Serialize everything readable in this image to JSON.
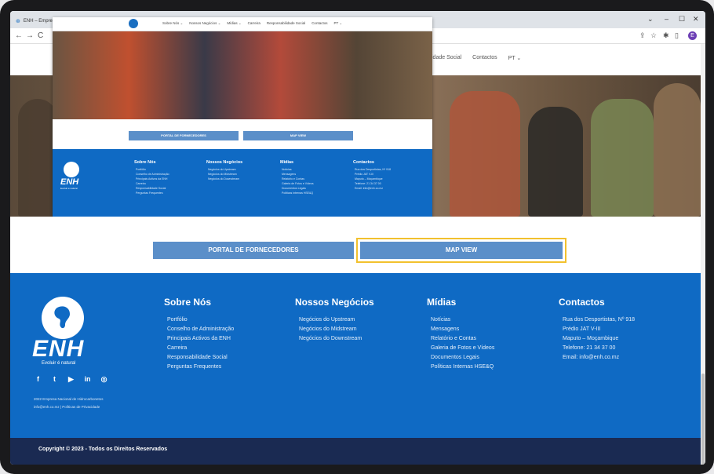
{
  "browser": {
    "tab_title": "ENH – Empre",
    "nav_back": "←",
    "nav_forward": "→",
    "nav_reload": "C",
    "profile_initial": "E",
    "win_min": "–",
    "win_max": "☐",
    "win_close": "✕",
    "tab_chevron": "⌄"
  },
  "bg_nav": [
    "idade Social",
    "Contactos",
    "PT ⌄"
  ],
  "overlay": {
    "nav": [
      "Sobre Nós ⌄",
      "Nossos Negócios ⌄",
      "Mídias ⌄",
      "Carreira",
      "Responsabilidade Social",
      "Contactos",
      "PT ⌄"
    ],
    "btn_fornecedores": "PORTAL DE FORNECEDORES",
    "btn_map": "MAP VIEW",
    "cols": [
      {
        "title": "Sobre Nós",
        "items": [
          "Portfólio",
          "Conselho de Administração",
          "Principais Activos da ENH",
          "Carreira",
          "Responsabilidade Social",
          "Perguntas Frequentes"
        ]
      },
      {
        "title": "Nossos Negócios",
        "items": [
          "Negócios do Upstream",
          "Negócios do Midstream",
          "Negócios do Downstream"
        ]
      },
      {
        "title": "Mídias",
        "items": [
          "Notícias",
          "Mensagens",
          "Relatório e Contas",
          "Galeria de Fotos e Vídeos",
          "Documentos Legais",
          "Políticas Internas HSE&Q"
        ]
      },
      {
        "title": "Contactos",
        "items": [
          "Rua dos Desportistas, Nº 918",
          "Prédio JAT V-III",
          "Maputo – Moçambique",
          "Telefone: 21 34 37 00",
          "Email: info@enh.co.mz"
        ]
      }
    ],
    "brand": "ENH",
    "brand_tag": "Evoluir é natural"
  },
  "main": {
    "btn_fornecedores": "PORTAL DE FORNECEDORES",
    "btn_map": "MAP VIEW"
  },
  "footer": {
    "brand": "ENH",
    "brand_tag": "Evoluir é natural",
    "social": [
      "f",
      "t",
      "▶",
      "in",
      "◎"
    ],
    "small1": "2022 Empresa Nacional de Hidrocarbonetos",
    "small2": "info@enh.co.mz | Políticas de Privacidade",
    "cols": [
      {
        "title": "Sobre Nós",
        "items": [
          "Portfólio",
          "Conselho de Administração",
          "Principais Activos da ENH",
          "Carreira",
          "Responsabilidade Social",
          "Perguntas Frequentes"
        ]
      },
      {
        "title": "Nossos Negócios",
        "items": [
          "Negócios do Upstream",
          "Negócios do Midstream",
          "Negócios do Downstream"
        ]
      },
      {
        "title": "Mídias",
        "items": [
          "Notícias",
          "Mensagens",
          "Relatório e Contas",
          "Galeria de Fotos e Vídeos",
          "Documentos Legais",
          "Políticas Internas HSE&Q"
        ]
      },
      {
        "title": "Contactos",
        "items": [
          "Rua dos Desportistas, Nº 918",
          "Prédio JAT V-III",
          "Maputo – Moçambique",
          "Telefone: 21 34 37 00",
          "Email: info@enh.co.mz"
        ]
      }
    ],
    "copyright": "Copyright © 2023 - Todos os Direitos Reservados"
  },
  "colors": {
    "footer_blue": "#0f6ac4",
    "button_blue": "#5b8fc9",
    "focus_yellow": "#f2c12e",
    "copyright_navy": "#1a2a52"
  }
}
